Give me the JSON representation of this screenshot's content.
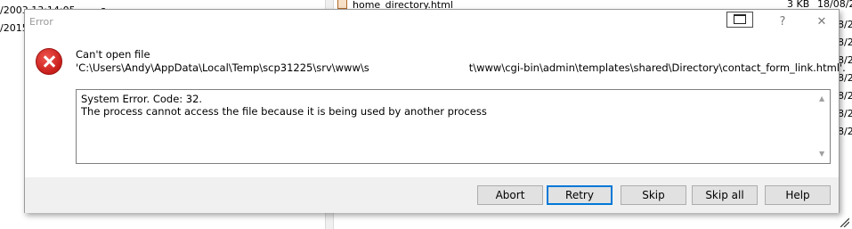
{
  "background": {
    "left_rows": [
      {
        "date": "/2003  13:14:05",
        "attr": "a"
      },
      {
        "date": "/2015",
        "attr": ""
      }
    ],
    "file_name": "home_directory.html",
    "file_size": "3 KB",
    "file_date": "18/08/2",
    "right_dates": [
      "18/08/2",
      "8/2",
      "8/2",
      "8/2",
      "8/2",
      "8/2",
      "8/2",
      "8/2"
    ]
  },
  "dialog": {
    "title": "Error",
    "titlebar": {
      "help_label": "?",
      "close_label": "✕"
    },
    "message_line1": "Can't open file",
    "path_prefix": "'C:\\Users\\Andy\\AppData\\Local\\Temp\\scp31225\\srv\\www\\s",
    "path_suffix": "t\\www\\cgi-bin\\admin\\templates\\shared\\Directory\\contact_form_link.html'.",
    "details": {
      "line1": "System Error.  Code: 32.",
      "line2": "The process cannot access the file because it is being used by another process"
    },
    "buttons": {
      "abort": "Abort",
      "retry": "Retry",
      "skip": "Skip",
      "skip_all": "Skip all",
      "help": "Help"
    }
  },
  "colors": {
    "accent": "#0078d7",
    "error_red": "#c81e1a"
  }
}
